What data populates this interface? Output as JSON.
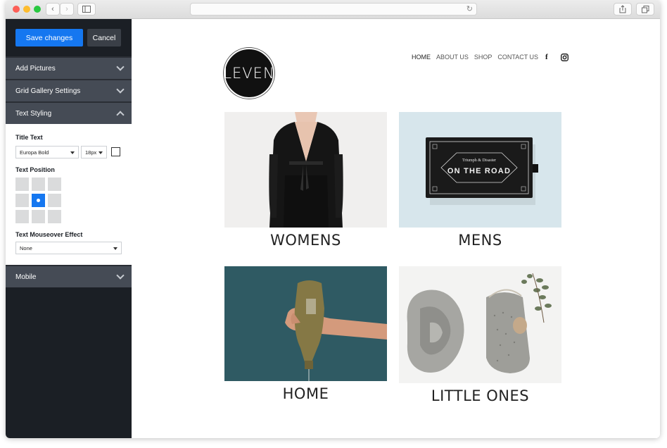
{
  "editor": {
    "save_label": "Save changes",
    "cancel_label": "Cancel",
    "sections": {
      "add_pictures": "Add Pictures",
      "grid_gallery": "Grid Gallery Settings",
      "text_styling": "Text Styling",
      "mobile": "Mobile"
    },
    "text_styling": {
      "title_text_label": "Title Text",
      "font_value": "Europa Bold",
      "size_value": "18px",
      "text_position_label": "Text Position",
      "selected_position": "middle-center",
      "mouseover_label": "Text Mouseover Effect",
      "mouseover_value": "None"
    }
  },
  "site": {
    "logo_text": "LEVEN",
    "nav": [
      "HOME",
      "ABOUT US",
      "SHOP",
      "CONTACT US"
    ],
    "social_icons": [
      "facebook-icon",
      "instagram-icon"
    ],
    "tiles": [
      {
        "caption": "WOMENS"
      },
      {
        "caption": "MENS"
      },
      {
        "caption": "HOME"
      },
      {
        "caption": "LITTLE ONES"
      }
    ],
    "box_text": {
      "brand": "Triumph & Disaster",
      "title": "ON THE ROAD"
    }
  },
  "colors": {
    "accent": "#1577f0",
    "sidebar_bg": "#1b1f25",
    "section_bg": "#454b55"
  }
}
